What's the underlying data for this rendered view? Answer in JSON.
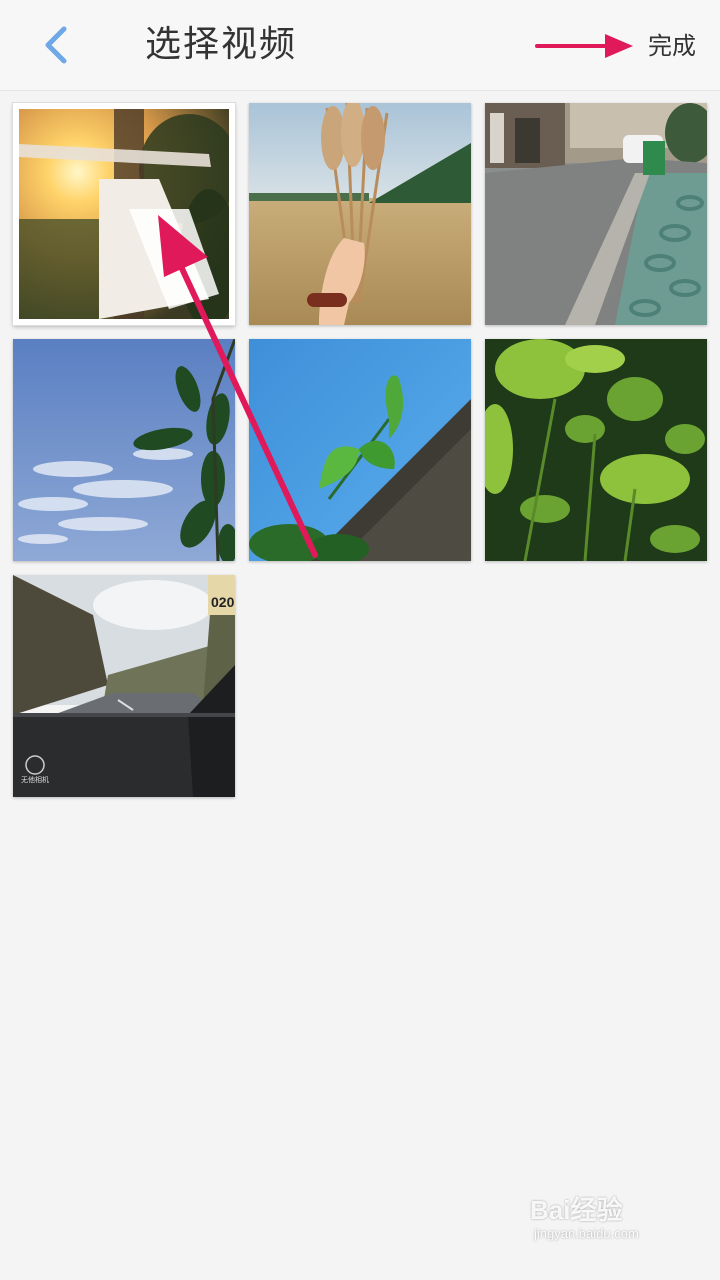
{
  "header": {
    "title": "选择视频",
    "done_label": "完成",
    "back_icon": "chevron-left-icon",
    "accent_color": "#6fa8e6"
  },
  "annotation_color": "#e0195a",
  "videos": [
    {
      "name": "scarecrow-sunset",
      "selected": true
    },
    {
      "name": "wheat-in-hand",
      "selected": false
    },
    {
      "name": "street-sidewalk",
      "selected": false
    },
    {
      "name": "sky-leaves",
      "selected": false
    },
    {
      "name": "ginkgo-leaf",
      "selected": false
    },
    {
      "name": "green-plants",
      "selected": false
    },
    {
      "name": "road-from-car",
      "selected": false
    }
  ],
  "thumb_overlays": {
    "road_sign_text": "020",
    "road_logo_text": "无他相机"
  },
  "watermark": {
    "main": "Bai经验",
    "sub": "jingyan.baidu.com"
  }
}
